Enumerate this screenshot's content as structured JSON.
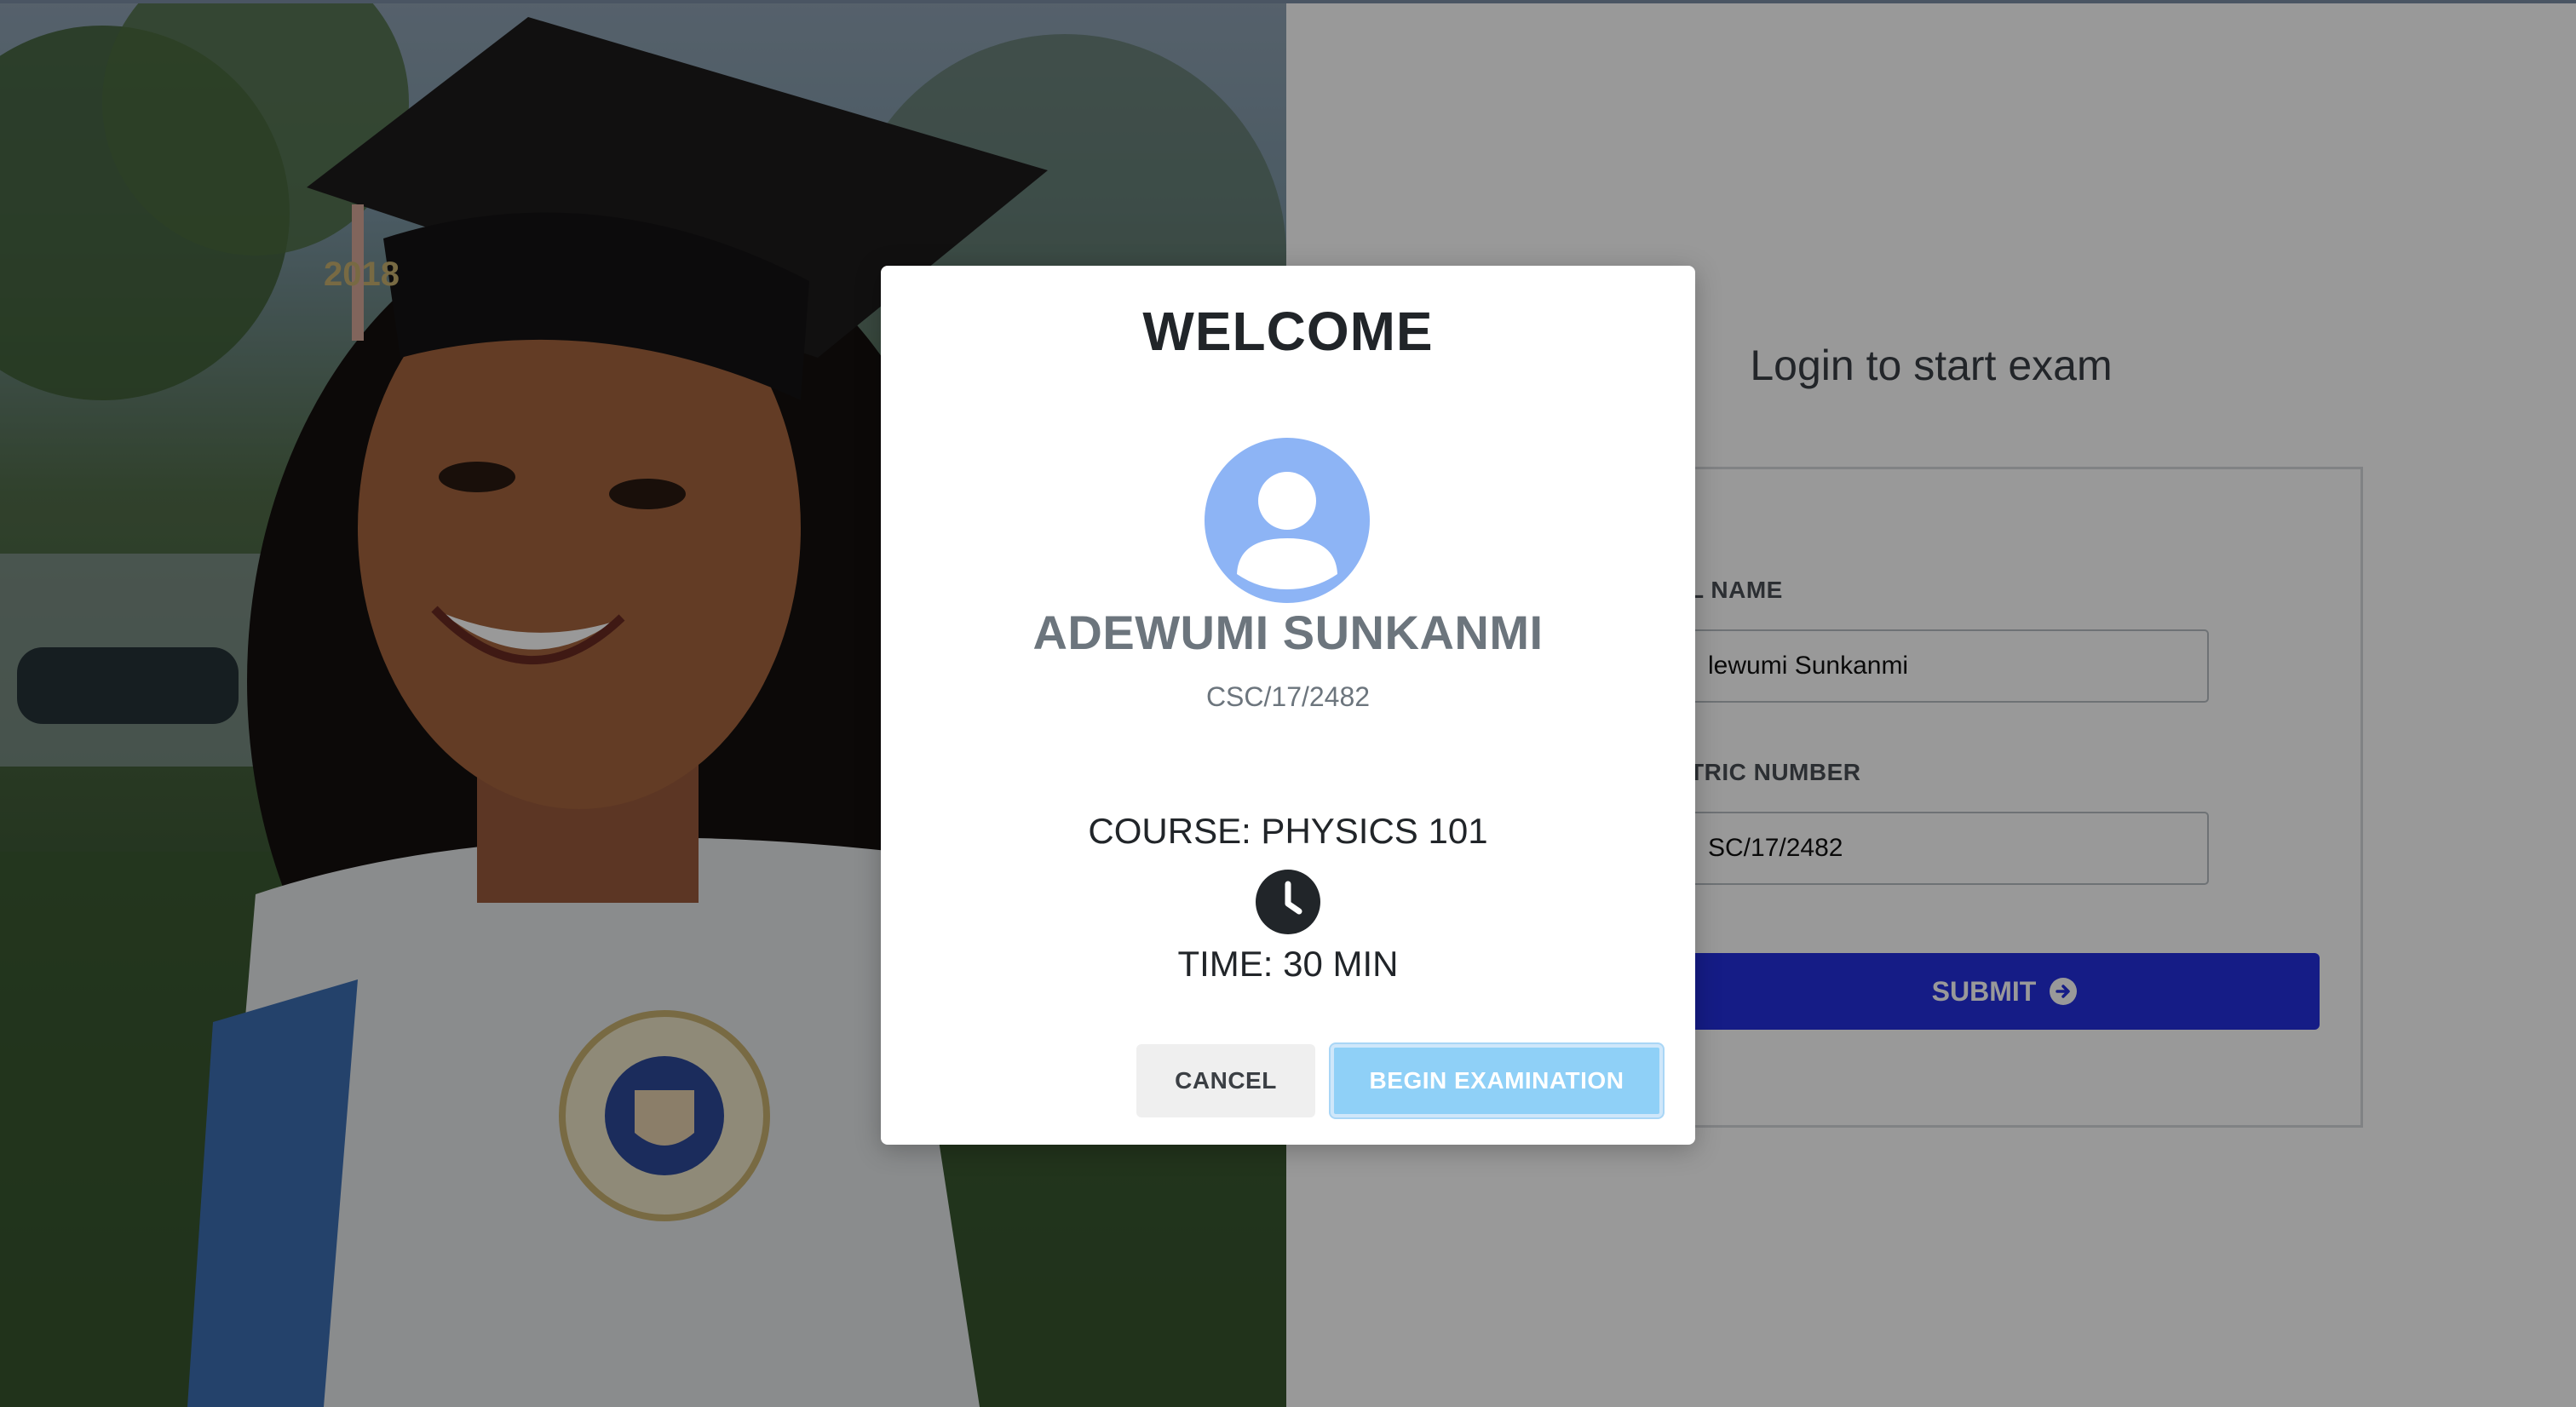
{
  "login": {
    "title": "Login to start exam",
    "fields": [
      {
        "label": "L NAME",
        "value": "lewumi Sunkanmi"
      },
      {
        "label": "TRIC NUMBER",
        "value": "SC/17/2482"
      }
    ],
    "submit_label": "SUBMIT",
    "submit_icon": "arrow-circle-right-icon"
  },
  "photo": {
    "cap_tassel_year": "2018"
  },
  "modal": {
    "title": "WELCOME",
    "avatar_icon": "user-avatar-icon",
    "student_name": "ADEWUMI SUNKANMI",
    "matric_number": "CSC/17/2482",
    "course": "COURSE: PHYSICS 101",
    "clock_icon": "clock-icon",
    "time": "TIME: 30 MIN",
    "cancel_label": "CANCEL",
    "begin_label": "BEGIN EXAMINATION"
  },
  "colors": {
    "primary": "#2430e0",
    "avatar": "#8db4f5",
    "begin_button": "#8fd0f7",
    "overlay": "rgba(0,0,0,0.40)"
  }
}
